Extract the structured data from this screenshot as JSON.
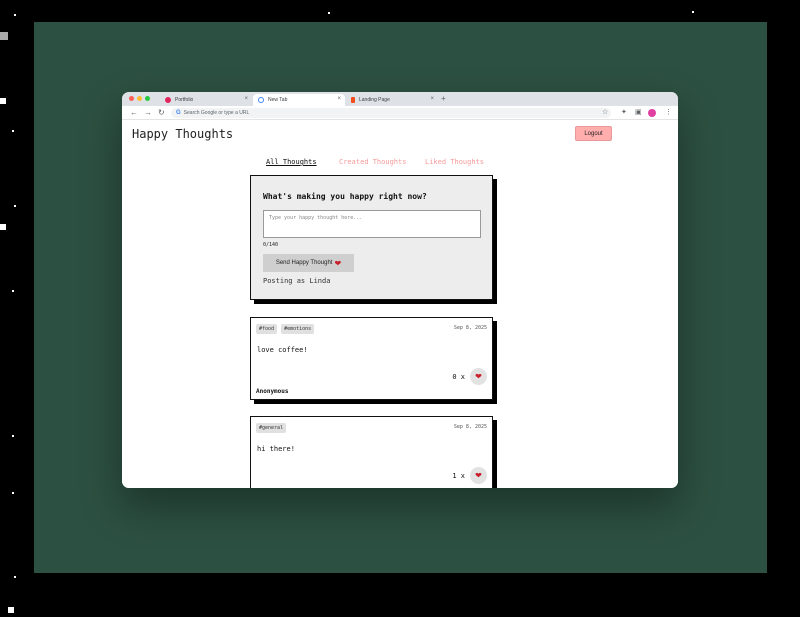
{
  "browser": {
    "tabs": [
      {
        "label": "Portfolio",
        "favicon_color": "#e0245e"
      },
      {
        "label": "New Tab",
        "favicon_color": "#4285f4"
      },
      {
        "label": "Landing Page",
        "favicon_color": "#f24e1e"
      }
    ],
    "close_glyph": "×",
    "new_tab_glyph": "+",
    "address_placeholder": "Search Google or type a URL"
  },
  "app": {
    "title": "Happy Thoughts",
    "logout_label": "Logout",
    "nav_tabs": [
      {
        "label": "All Thoughts",
        "active": true
      },
      {
        "label": "Created Thoughts",
        "active": false
      },
      {
        "label": "Liked Thoughts",
        "active": false
      }
    ]
  },
  "form": {
    "heading": "What's making you happy right now?",
    "placeholder": "Type your happy thought here...",
    "counter": "0/140",
    "send_label": "Send Happy Thought",
    "posting_as": "Posting as Linda"
  },
  "thoughts": [
    {
      "tags": [
        "#food",
        "#emotions"
      ],
      "date": "Sep 8, 2025",
      "message": "love coffee!",
      "likes": "0 x",
      "author": "Anonymous"
    },
    {
      "tags": [
        "#general"
      ],
      "date": "Sep 8, 2025",
      "message": "hi there!",
      "likes": "1 x",
      "author": ""
    }
  ],
  "colors": {
    "background": "#2c5041",
    "accent_pink": "#ffadad",
    "inactive_tab": "#f59a9a",
    "heart": "#c81e2a"
  }
}
